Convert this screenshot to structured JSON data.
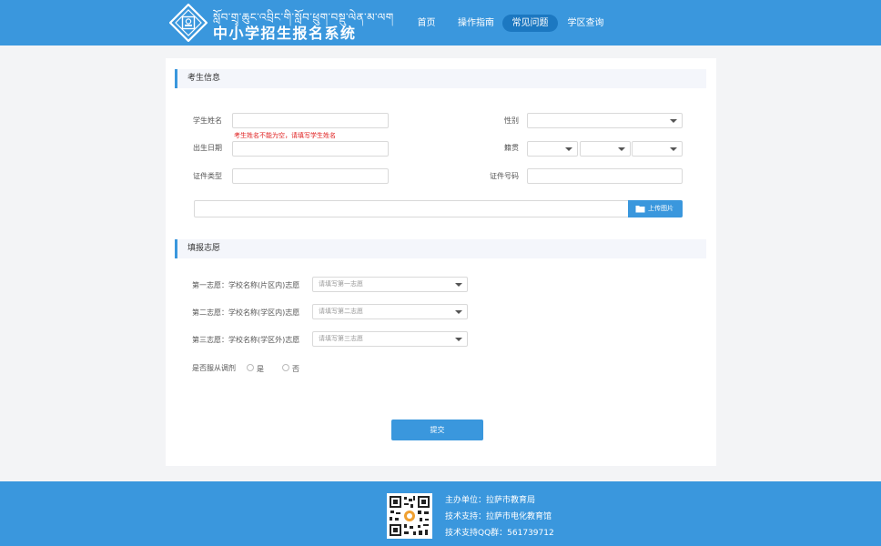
{
  "header": {
    "tibetan_title": "སློབ་གྲྭ་ཆུང་འབྲིང་གི་སློབ་ཕྲུག་བསྡུ་ལེན་མ་ལག",
    "title": "中小学招生报名系统",
    "nav": [
      {
        "label": "首页",
        "active": false
      },
      {
        "label": "操作指南",
        "active": false
      },
      {
        "label": "常见问题",
        "active": true
      },
      {
        "label": "学区查询",
        "active": false
      }
    ]
  },
  "student_section": {
    "title": "考生信息",
    "name_label": "学生姓名",
    "name_value": "",
    "name_error": "考生姓名不能为空，请填写学生姓名",
    "gender_label": "性别",
    "gender_value": "",
    "birth_label": "出生日期",
    "birth_value": "",
    "origin_label": "籍贯",
    "origin_values": [
      "",
      "",
      ""
    ],
    "id_type_label": "证件类型",
    "id_type_value": "",
    "id_number_label": "证件号码",
    "id_number_value": "",
    "upload_label": "上传图片"
  },
  "choice_section": {
    "title": "填报志愿",
    "choices": [
      {
        "label": "第一志愿：学校名称(片区内)志愿",
        "placeholder": "请填写第一志愿"
      },
      {
        "label": "第二志愿：学校名称(学区内)志愿",
        "placeholder": "请填写第二志愿"
      },
      {
        "label": "第三志愿：学校名称(学区外)志愿",
        "placeholder": "请填写第三志愿"
      }
    ],
    "adjust_label": "是否服从调剂",
    "adjust_yes": "是",
    "adjust_no": "否"
  },
  "submit_label": "提交",
  "footer": {
    "organizer": "主办单位：拉萨市教育局",
    "tech_support": "技术支持：拉萨市电化教育馆",
    "qq_group": "技术支持QQ群：561739712"
  },
  "colors": {
    "brand": "#3a97dd",
    "nav_active": "#1c78c1",
    "error": "#e02222"
  }
}
